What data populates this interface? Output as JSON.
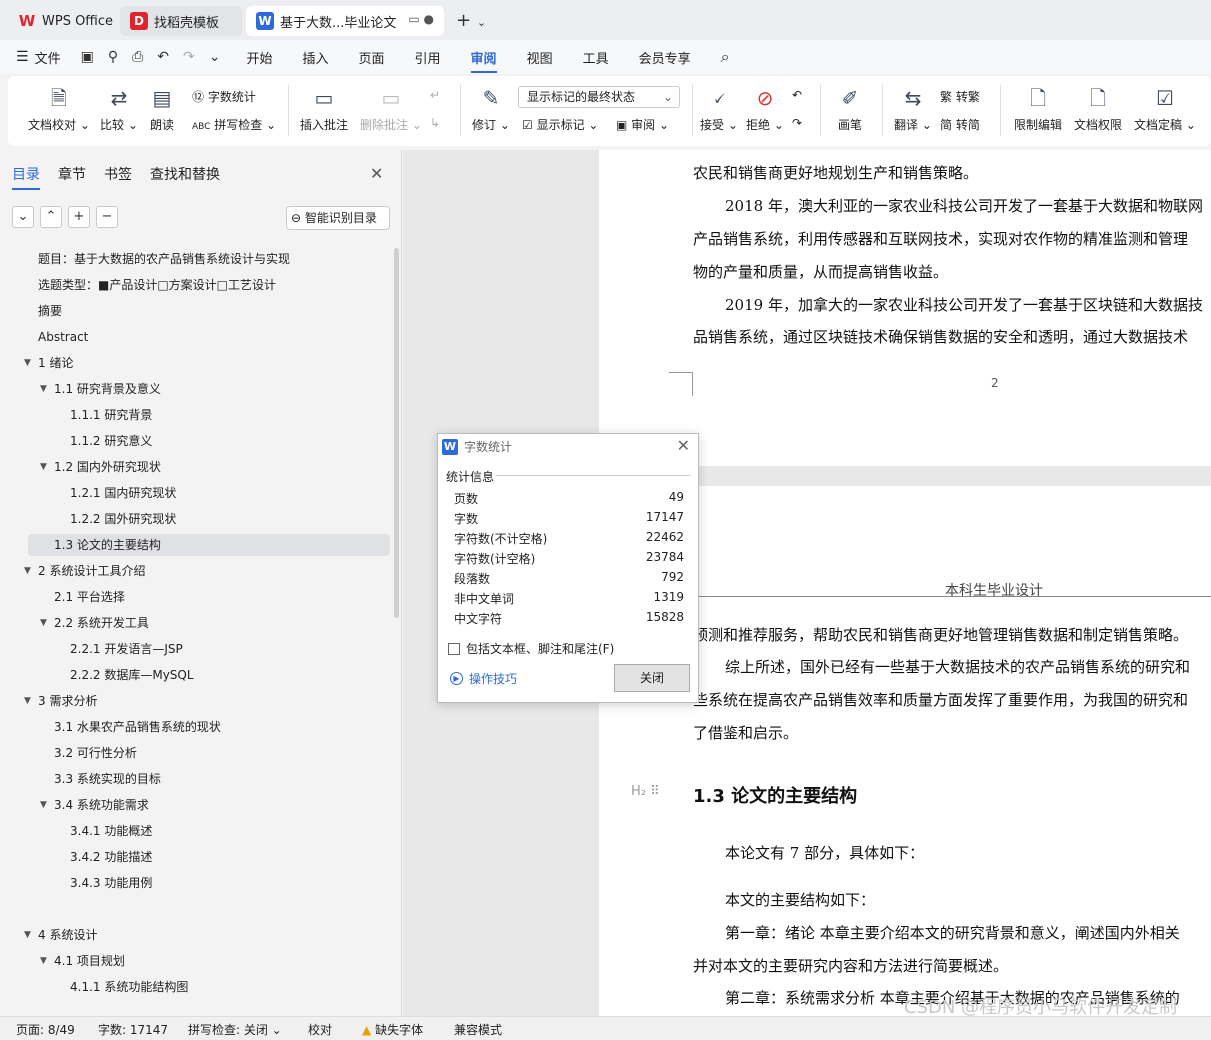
{
  "tabs": {
    "wps": "WPS Office",
    "template": "找稻壳模板",
    "document": "基于大数...毕业论文",
    "new_tab": "+"
  },
  "menu": {
    "file": "文件",
    "items": [
      "开始",
      "插入",
      "页面",
      "引用",
      "审阅",
      "视图",
      "工具",
      "会员专享"
    ],
    "active": "审阅"
  },
  "ribbon": {
    "proofread": "文档校对",
    "compare": "比较",
    "read_aloud": "朗读",
    "word_count": "字数统计",
    "spell_check": "拼写检查",
    "insert_comment": "插入批注",
    "delete_comment": "删除批注",
    "revision": "修订",
    "markup_select": "显示标记的最终状态",
    "show_markup": "显示标记",
    "review_pane": "审阅",
    "accept": "接受",
    "reject": "拒绝",
    "ink": "画笔",
    "translate": "翻译",
    "to_traditional": "转繁",
    "to_simplified": "转简",
    "restrict_edit": "限制编辑",
    "doc_permission": "文档权限",
    "finalize": "文档定稿"
  },
  "nav": {
    "tabs": [
      "目录",
      "章节",
      "书签",
      "查找和替换"
    ],
    "smart_toc": "智能识别目录",
    "toc": [
      "题目：基于大数据的农产品销售系统设计与实现",
      "选题类型：■产品设计□方案设计□工艺设计",
      "摘要",
      "Abstract",
      "1   绪论",
      "1.1 研究背景及意义",
      "1.1.1 研究背景",
      "1.1.2 研究意义",
      "1.2 国内外研究现状",
      "1.2.1 国内研究现状",
      "1.2.2 国外研究现状",
      "1.3  论文的主要结构",
      "2   系统设计工具介绍",
      "2.1  平台选择",
      "2.2  系统开发工具",
      "2.2.1  开发语言—JSP",
      "2.2.2  数据库—MySQL",
      "3   需求分析",
      "3.1  水果农产品销售系统的现状",
      "3.2  可行性分析",
      "3.3  系统实现的目标",
      "3.4  系统功能需求",
      "3.4.1  功能概述",
      "3.4.2  功能描述",
      "3.4.3  功能用例",
      "4   系统设计",
      "4.1  项目规划",
      "4.1.1  系统功能结构图"
    ]
  },
  "doc": {
    "p1_lines": [
      "农民和销售商更好地规划生产和销售策略。",
      "2018 年，澳大利亚的一家农业科技公司开发了一套基于大数据和物联网",
      "产品销售系统，利用传感器和互联网技术，实现对农作物的精准监测和管理",
      "物的产量和质量，从而提高销售收益。",
      "2019 年，加拿大的一家农业科技公司开发了一套基于区块链和大数据技",
      "品销售系统，通过区块链技术确保销售数据的安全和透明，通过大数据技术"
    ],
    "page_number": "2",
    "header": "本科生毕业设计",
    "p2_lines": [
      "预测和推荐服务，帮助农民和销售商更好地管理销售数据和制定销售策略。",
      "综上所述，国外已经有一些基于大数据技术的农产品销售系统的研究和",
      "些系统在提高农产品销售效率和质量方面发挥了重要作用，为我国的研究和",
      "了借鉴和启示。"
    ],
    "heading_mark": "H₂ ⠿",
    "heading": "1.3  论文的主要结构",
    "p3_lines": [
      "本论文有 7 部分，具体如下：",
      "本文的主要结构如下：",
      "第一章：绪论  本章主要介绍本文的研究背景和意义，阐述国内外相关",
      "并对本文的主要研究内容和方法进行简要概述。",
      "第二章：系统需求分析  本章主要介绍基于大数据的农产品销售系统的"
    ]
  },
  "word_count_dialog": {
    "title": "字数统计",
    "section": "统计信息",
    "rows": [
      {
        "k": "页数",
        "v": "49"
      },
      {
        "k": "字数",
        "v": "17147"
      },
      {
        "k": "字符数(不计空格)",
        "v": "22462"
      },
      {
        "k": "字符数(计空格)",
        "v": "23784"
      },
      {
        "k": "段落数",
        "v": "792"
      },
      {
        "k": "非中文单词",
        "v": "1319"
      },
      {
        "k": "中文字符",
        "v": "15828"
      }
    ],
    "include_label": "包括文本框、脚注和尾注(F)",
    "tips": "操作技巧",
    "close": "关闭"
  },
  "status": {
    "page": "页面: 8/49",
    "words": "字数: 17147",
    "spell": "拼写检查: 关闭",
    "proof": "校对",
    "missing_font": "缺失字体",
    "compat": "兼容模式"
  },
  "watermark": "CSDN @程序员小马软件开发定制"
}
